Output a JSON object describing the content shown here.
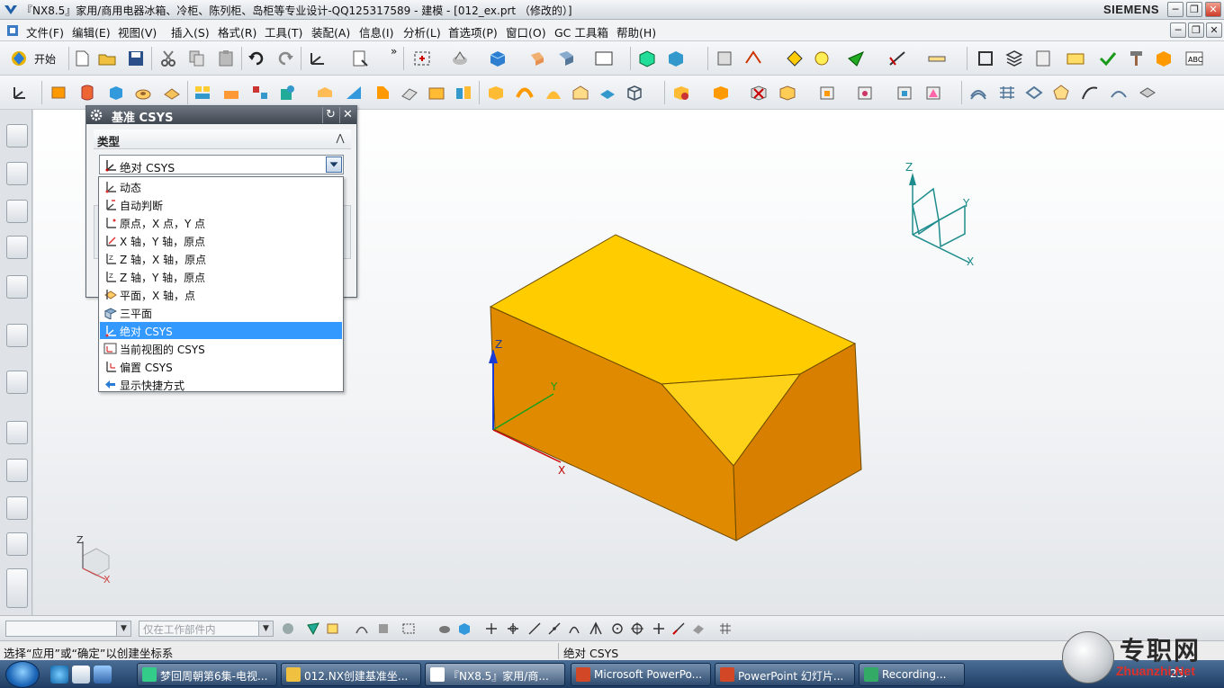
{
  "window": {
    "title": "『NX8.5』家用/商用电器冰箱、冷柜、陈列柜、岛柜等专业设计-QQ125317589 - 建模 - [012_ex.prt （修改的）]",
    "brand": "SIEMENS",
    "minimize": "─",
    "restore": "❐",
    "close": "✕"
  },
  "menubar": {
    "items": [
      "文件(F)",
      "编辑(E)",
      "视图(V)",
      "插入(S)",
      "格式(R)",
      "工具(T)",
      "装配(A)",
      "信息(I)",
      "分析(L)",
      "首选项(P)",
      "窗口(O)",
      "GC 工具箱",
      "帮助(H)"
    ]
  },
  "toolbar1": {
    "start_label": "开始",
    "overflow": "»"
  },
  "dialog": {
    "title": "基准 CSYS",
    "section_label": "类型",
    "selected_type": "绝对 CSYS",
    "reset_icon": "↻",
    "close_icon": "✕",
    "collapse_icon": "⋀"
  },
  "dropdown": {
    "items": [
      "动态",
      "自动判断",
      "原点，X 点，Y 点",
      "X 轴，Y 轴，原点",
      "Z 轴，X 轴，原点",
      "Z 轴，Y 轴，原点",
      "平面，X 轴，点",
      "三平面",
      "绝对 CSYS",
      "当前视图的 CSYS",
      "偏置 CSYS",
      "显示快捷方式"
    ],
    "selected_index": 8
  },
  "axes": {
    "model_z": "Z",
    "model_y": "Y",
    "model_x": "X",
    "wcs_z": "Z",
    "wcs_y": "Y",
    "wcs_x": "X",
    "tri_z": "Z",
    "tri_x": "X"
  },
  "selection_bar": {
    "filter_placeholder": "",
    "scope": "仅在工作部件内"
  },
  "status": {
    "prompt": "选择“应用”或“确定”以创建坐标系",
    "current": "绝对 CSYS"
  },
  "taskbar": {
    "tasks": [
      "梦回周朝第6集-电视...",
      "012.NX创建基准坐...",
      "『NX8.5』家用/商...",
      "Microsoft PowerPo...",
      "PowerPoint 幻灯片...",
      "Recording..."
    ],
    "active_index": 2,
    "clock": "23:"
  },
  "watermark": {
    "cn": "专职网",
    "url": "Zhuanzhi.Net"
  },
  "colors": {
    "box_top": "#FFCC00",
    "box_front": "#E08A00",
    "box_side": "#D97F00",
    "box_bevel": "#FFD21A",
    "axis_teal": "#1E8C8C",
    "selection_blue": "#3399FF"
  }
}
